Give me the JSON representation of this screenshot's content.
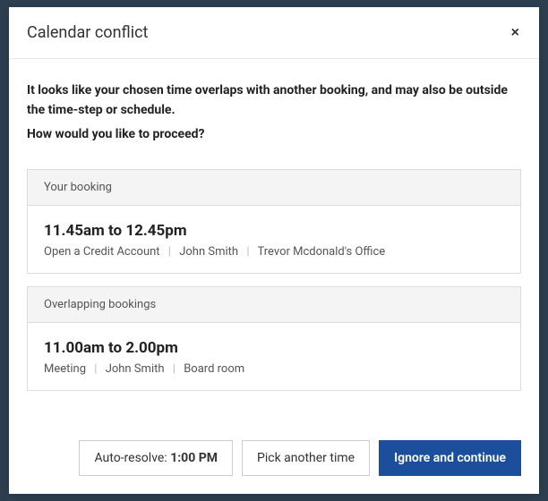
{
  "modal": {
    "title": "Calendar conflict",
    "close_label": "×",
    "intro_line1": "It looks like your chosen time overlaps with another booking, and may also be outside the time-step or schedule.",
    "intro_line2": "How would you like to proceed?"
  },
  "your_booking": {
    "header": "Your booking",
    "time": "11.45am to 12.45pm",
    "title": "Open a Credit Account",
    "person": "John Smith",
    "location": "Trevor Mcdonald's Office"
  },
  "overlapping": {
    "header": "Overlapping bookings",
    "time": "11.00am to 2.00pm",
    "title": "Meeting",
    "person": "John Smith",
    "location": "Board room"
  },
  "footer": {
    "auto_resolve_label": "Auto-resolve: ",
    "auto_resolve_time": "1:00 PM",
    "pick_label": "Pick another time",
    "ignore_label": "Ignore and continue"
  },
  "sep": "|"
}
